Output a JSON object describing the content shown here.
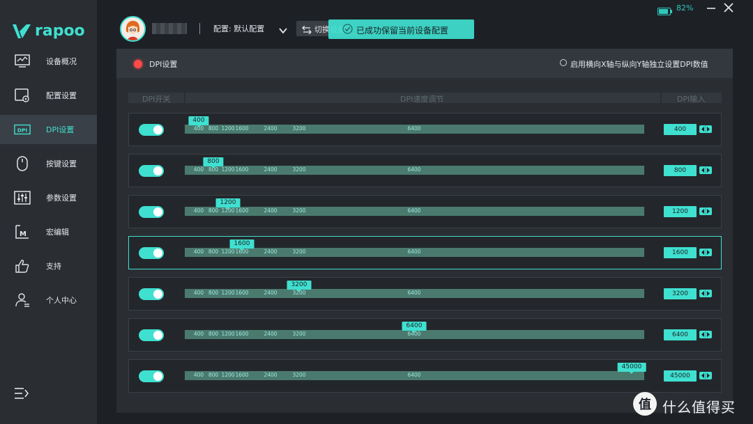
{
  "app": {
    "brand": "rapoo",
    "accent": "#3fe0d0",
    "battery_percent": "82%"
  },
  "sidebar": {
    "items": [
      {
        "label": "设备概况",
        "icon": "chart-monitor-icon"
      },
      {
        "label": "配置设置",
        "icon": "config-gear-icon"
      },
      {
        "label": "DPI设置",
        "icon": "dpi-icon",
        "active": true
      },
      {
        "label": "按键设置",
        "icon": "mouse-icon"
      },
      {
        "label": "参数设置",
        "icon": "sliders-icon"
      },
      {
        "label": "宏编辑",
        "icon": "macro-icon"
      },
      {
        "label": "支持",
        "icon": "thumbs-up-icon"
      },
      {
        "label": "个人中心",
        "icon": "user-center-icon"
      }
    ]
  },
  "header": {
    "profile_label": "配置: 默认配置",
    "switch_label": "切换设备",
    "toast": "已成功保留当前设备配置"
  },
  "panel": {
    "title": "DPI设置",
    "option_label": "启用横向X轴与纵向Y轴独立设置DPI数值",
    "columns": {
      "switch": "DPI开关",
      "slider": "DPI速度调节",
      "input": "DPI输入"
    },
    "ticks": [
      "400",
      "800",
      "1200",
      "1600",
      "2400",
      "3200",
      "6400"
    ],
    "rows": [
      {
        "value": "400",
        "enabled": true
      },
      {
        "value": "800",
        "enabled": true
      },
      {
        "value": "1200",
        "enabled": true
      },
      {
        "value": "1600",
        "enabled": true,
        "selected": true
      },
      {
        "value": "3200",
        "enabled": true
      },
      {
        "value": "6400",
        "enabled": true
      },
      {
        "value": "45000",
        "enabled": true
      }
    ]
  },
  "watermark": {
    "badge": "值",
    "text": "什么值得买"
  }
}
